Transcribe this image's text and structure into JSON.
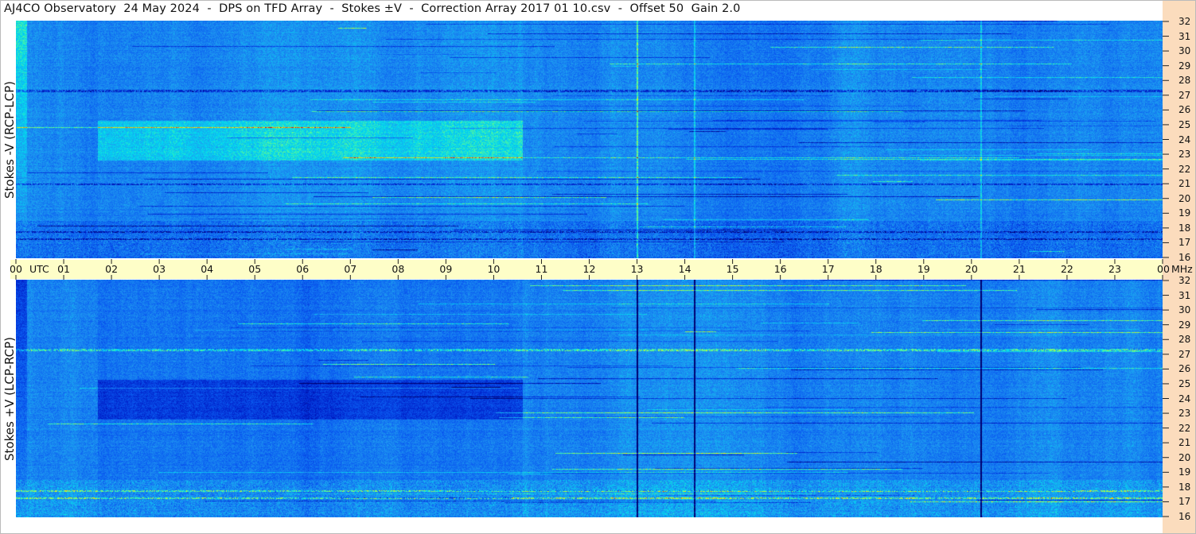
{
  "title": "AJ4CO Observatory  24 May 2024  -  DPS on TFD Array  -  Stokes ±V  -  Correction Array 2017 01 10.csv  -  Offset 50  Gain 2.0",
  "colors": {
    "time_band": "#fefec8",
    "freq_panel": "#fbdcbd",
    "colormap": [
      "#00008b",
      "#0000ff",
      "#1e6ee6",
      "#00ffff",
      "#ffff00",
      "#ff8800",
      "#ff0000"
    ]
  },
  "chart_data": [
    {
      "type": "heatmap",
      "ylabel": "Stokes -V  (RCP-LCP)",
      "x_hours": [
        "00",
        "01",
        "02",
        "03",
        "04",
        "05",
        "06",
        "07",
        "08",
        "09",
        "10",
        "11",
        "12",
        "13",
        "14",
        "15",
        "16",
        "17",
        "18",
        "19",
        "20",
        "21",
        "22",
        "23",
        "00"
      ],
      "x_unit": "UTC",
      "x_range_utc": [
        0,
        24
      ],
      "y_range_mhz": [
        16,
        32
      ],
      "y_ticks": [
        "32",
        "31",
        "30",
        "29",
        "28",
        "27",
        "26",
        "25",
        "24",
        "23",
        "22",
        "21",
        "20",
        "19",
        "18",
        "17",
        "16"
      ],
      "y_unit": "MHz",
      "features": {
        "vertical_lines_utc": [
          13.0,
          14.2,
          20.2
        ],
        "dark_region_utc": [
          1.7,
          10.6
        ],
        "dark_region_mhz": [
          22.6,
          25.3
        ],
        "bright_bands_mhz": [
          17.3,
          17.8,
          21.0,
          27.3
        ]
      }
    },
    {
      "type": "heatmap",
      "ylabel": "Stokes +V  (LCP-RCP)",
      "x_hours": [
        "00",
        "01",
        "02",
        "03",
        "04",
        "05",
        "06",
        "07",
        "08",
        "09",
        "10",
        "11",
        "12",
        "13",
        "14",
        "15",
        "16",
        "17",
        "18",
        "19",
        "20",
        "21",
        "22",
        "23",
        "00"
      ],
      "x_unit": "UTC",
      "x_range_utc": [
        0,
        24
      ],
      "y_range_mhz": [
        16,
        32
      ],
      "y_ticks": [
        "32",
        "31",
        "30",
        "29",
        "28",
        "27",
        "26",
        "25",
        "24",
        "23",
        "22",
        "21",
        "20",
        "19",
        "18",
        "17",
        "16"
      ],
      "y_unit": "MHz",
      "features": {
        "vertical_lines_utc": [
          13.0,
          14.2,
          20.2
        ],
        "bright_region_utc": [
          1.7,
          10.6
        ],
        "bright_region_mhz": [
          22.6,
          25.3
        ],
        "dark_bands_mhz": [
          17.3,
          17.8,
          27.3
        ]
      }
    }
  ]
}
